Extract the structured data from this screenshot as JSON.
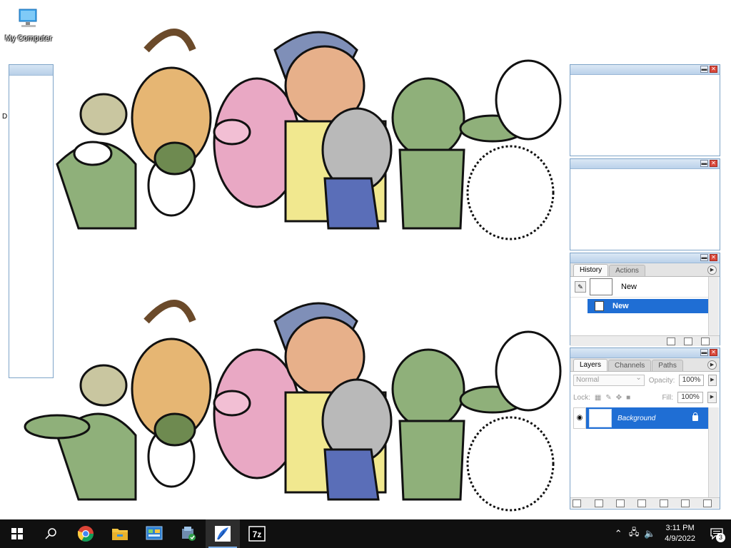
{
  "desktop": {
    "icon_label": "My Computer",
    "stray_letter": "D"
  },
  "history_panel": {
    "tabs": [
      "History",
      "Actions"
    ],
    "snapshot_label": "New",
    "state_label": "New"
  },
  "layers_panel": {
    "tabs": [
      "Layers",
      "Channels",
      "Paths"
    ],
    "blend_mode": "Normal",
    "opacity_label": "Opacity:",
    "opacity_value": "100%",
    "lock_label": "Lock:",
    "fill_label": "Fill:",
    "fill_value": "100%",
    "layer_name": "Background"
  },
  "taskbar": {
    "time": "3:11 PM",
    "date": "4/9/2022",
    "notification_count": "3",
    "apps": [
      "start",
      "search",
      "chrome",
      "file-explorer",
      "control-panel",
      "installer",
      "photoshop",
      "7zip"
    ]
  },
  "colors": {
    "selection_blue": "#1f6ed4",
    "taskbar_bg": "#101010",
    "panel_border": "#7ea4c8"
  }
}
